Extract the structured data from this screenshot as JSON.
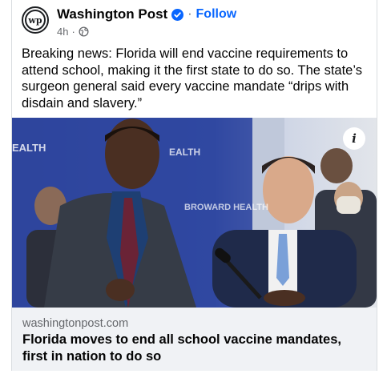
{
  "post": {
    "page_name": "Washington Post",
    "follow_label": "Follow",
    "separator": "·",
    "timestamp": "4h",
    "meta_separator": "·",
    "avatar_letters": "wp",
    "text": "Breaking news: Florida will end vaccine requirements to attend school, making it the first state to do so. The state’s surgeon general said every vaccine mandate “drips with disdain and slavery.”"
  },
  "media": {
    "info_label": "i",
    "backdrop_text": [
      "EALTH",
      "EALTH",
      "BROWARD HEALTH"
    ]
  },
  "link": {
    "domain": "washingtonpost.com",
    "title": "Florida moves to end all school vaccine mandates, first in nation to do so"
  },
  "colors": {
    "link_blue": "#0866ff",
    "verified_blue": "#0866ff",
    "secondary_text": "#65676b",
    "preview_bg": "#f0f2f5",
    "backdrop_blue": "#2b3e8e"
  },
  "icons": [
    "verified-badge-icon",
    "globe-icon",
    "info-icon"
  ]
}
